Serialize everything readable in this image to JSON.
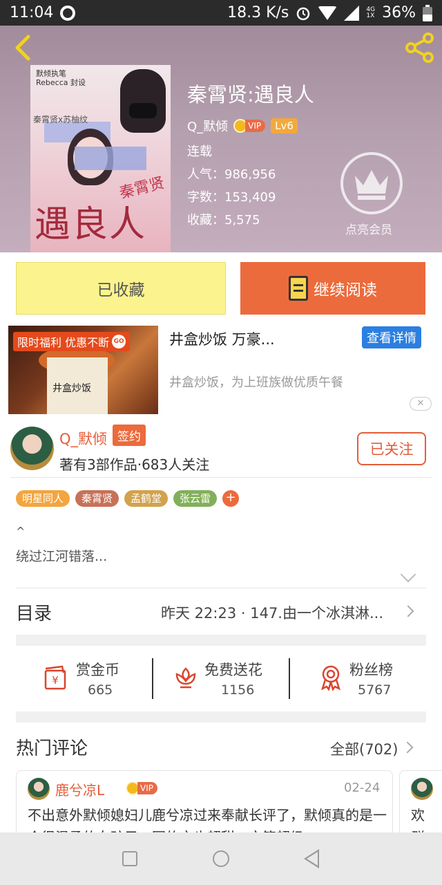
{
  "status_bar": {
    "time": "11:04",
    "net_speed": "18.3 K/s",
    "lte_top": "4G",
    "lte_bottom": "1X",
    "battery": "36%"
  },
  "book": {
    "title": "秦霄贤:遇良人",
    "author": "Q_默倾",
    "vip_label": "VIP",
    "level": "Lv6",
    "status": "连载",
    "popularity": "人气：986,956",
    "word_count": "字数：153,409",
    "favorites": "收藏：5,575",
    "cover": {
      "author_line1": "默倾执笔",
      "author_line2": "Rebecca 封设",
      "pairing": "秦霄贤x苏柚纹",
      "title": "遇良人",
      "subtitle": "秦霄贤"
    }
  },
  "member": {
    "label": "点亮会员"
  },
  "actions": {
    "favorited_label": "已收藏",
    "continue_label": "继续阅读"
  },
  "ad": {
    "tag": "限时福利 优惠不断",
    "go_label": "GO",
    "box_label": "井盒炒饭",
    "title": "井盒炒饭 万豪...",
    "detail_label": "查看详情",
    "description": "井盒炒饭，为上班族做优质午餐",
    "close_glyph": "✕"
  },
  "author_card": {
    "name": "Q_默倾",
    "sign_label": "签约",
    "meta": "著有3部作品·683人关注",
    "follow_label": "已关注"
  },
  "tags": [
    {
      "label": "明星同人",
      "color": "#f3a53f"
    },
    {
      "label": "秦霄贤",
      "color": "#c77159"
    },
    {
      "label": "孟鹤堂",
      "color": "#d2a24c"
    },
    {
      "label": "张云雷",
      "color": "#82b05a"
    }
  ],
  "tag_add": "+",
  "intro": {
    "caret": "^",
    "text": "绕过江河错落..."
  },
  "toc": {
    "title": "目录",
    "latest": "昨天 22:23 · 147.由一个冰淇淋..."
  },
  "stats": [
    {
      "label": "赏金币",
      "value": "665"
    },
    {
      "label": "免费送花",
      "value": "1156"
    },
    {
      "label": "粉丝榜",
      "value": "5767"
    }
  ],
  "comments": {
    "title": "热门评论",
    "all_label": "全部(702)",
    "items": [
      {
        "user": "鹿兮凉L",
        "vip_label": "VIP",
        "date": "02-24",
        "text": "不出意外默倾媳妇儿鹿兮凉过来奉献长评了，默倾真的是一个很温柔的女孩子，写的文也超甜，文笔超级"
      },
      {
        "text": "欢群"
      }
    ]
  },
  "colors": {
    "accent": "#ec6b3c",
    "header_bg": "#b49fae",
    "favorite_bg": "#fbf38d",
    "link_blue": "#2b7fe1",
    "icon_red": "#d9452e"
  }
}
